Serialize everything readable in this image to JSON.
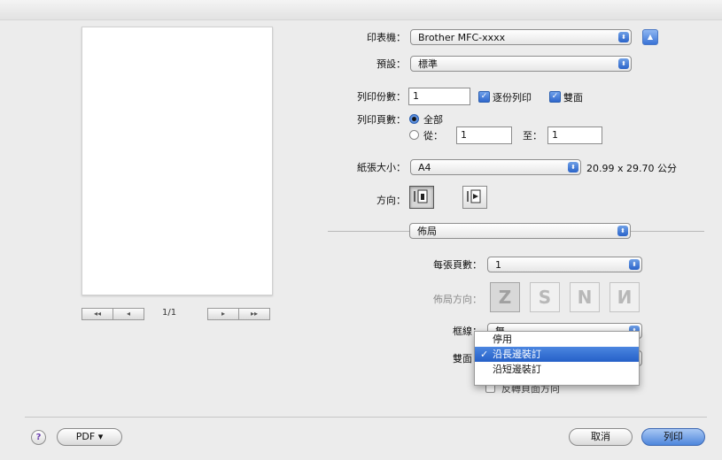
{
  "preview": {
    "page_count": "1/1",
    "nav_first": "◂◂",
    "nav_prev": "◂",
    "nav_next": "▸",
    "nav_last": "▸▸"
  },
  "printer": {
    "label": "印表機：",
    "value": "Brother MFC-xxxx"
  },
  "presets": {
    "label": "預設：",
    "value": "標準"
  },
  "copies": {
    "label": "列印份數：",
    "value": "1",
    "collated_label": "逐份列印",
    "collated": true,
    "duplex_label": "雙面",
    "duplex": true
  },
  "pages": {
    "label": "列印頁數：",
    "all_label": "全部",
    "from_label": "從：",
    "from_value": "1",
    "to_label": "至：",
    "to_value": "1"
  },
  "paper_size": {
    "label": "紙張大小：",
    "value": "A4",
    "dimensions": "20.99 x 29.70 公分"
  },
  "orientation": {
    "label": "方向："
  },
  "section_popup": {
    "value": "佈局"
  },
  "layout": {
    "pages_per_sheet_label": "每張頁數：",
    "pages_per_sheet_value": "1",
    "direction_label": "佈局方向：",
    "border_label": "框線：",
    "border_value": "無",
    "two_sided_label": "雙面：",
    "reverse_label": "反轉頁面方向"
  },
  "two_sided_menu": {
    "items": [
      "停用",
      "沿長邊裝訂",
      "沿短邊裝訂"
    ],
    "selected_index": 1
  },
  "footer": {
    "help_label": "?",
    "pdf_label": "PDF ▾",
    "cancel_label": "取消",
    "print_label": "列印"
  },
  "colors": {
    "accent": "#2a64c9",
    "highlight": "#2f6ad0"
  }
}
